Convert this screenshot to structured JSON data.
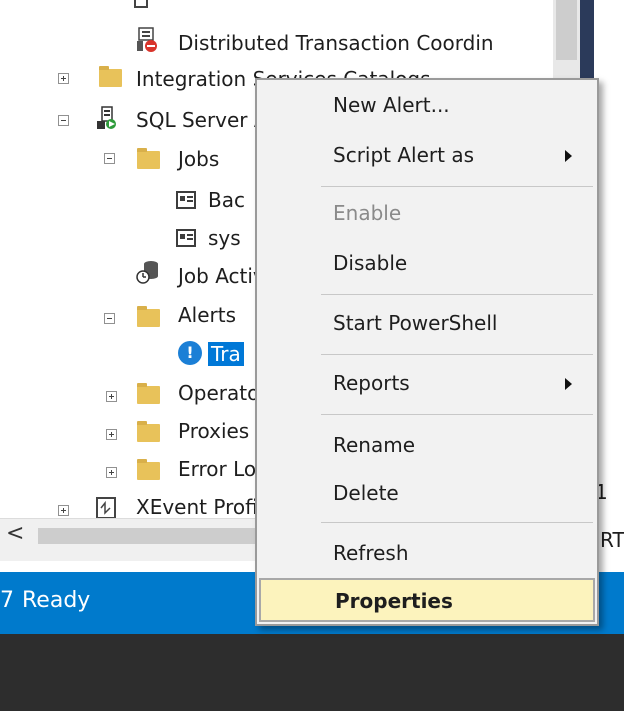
{
  "tree": {
    "items": [
      {
        "label": "Distributed Transaction Coordin"
      },
      {
        "label": "Integration Services Catalogs"
      },
      {
        "label": "SQL Server Agent"
      },
      {
        "label": "Jobs"
      },
      {
        "label": "Bac"
      },
      {
        "label": "sys"
      },
      {
        "label": "Job Activity Monitor"
      },
      {
        "label": "Alerts"
      },
      {
        "label": "Tra"
      },
      {
        "label": "Operators"
      },
      {
        "label": "Proxies"
      },
      {
        "label": "Error Logs"
      },
      {
        "label": "XEvent Profiler"
      }
    ]
  },
  "hscroll": {
    "left_arrow": "<"
  },
  "right_panel": {
    "snippet1": "1",
    "snippet2": "RT"
  },
  "statusbar": {
    "text": "Ready",
    "glyph": "7"
  },
  "context_menu": {
    "items": [
      {
        "label": "New Alert..."
      },
      {
        "label": "Script Alert as"
      },
      {
        "label": "Enable"
      },
      {
        "label": "Disable"
      },
      {
        "label": "Start PowerShell"
      },
      {
        "label": "Reports"
      },
      {
        "label": "Rename"
      },
      {
        "label": "Delete"
      },
      {
        "label": "Refresh"
      },
      {
        "label": "Properties"
      }
    ]
  },
  "colors": {
    "status_bar": "#007acc",
    "menu_highlight": "#fcf3bd",
    "selection": "#0078d7",
    "folder": "#e8c25a"
  }
}
